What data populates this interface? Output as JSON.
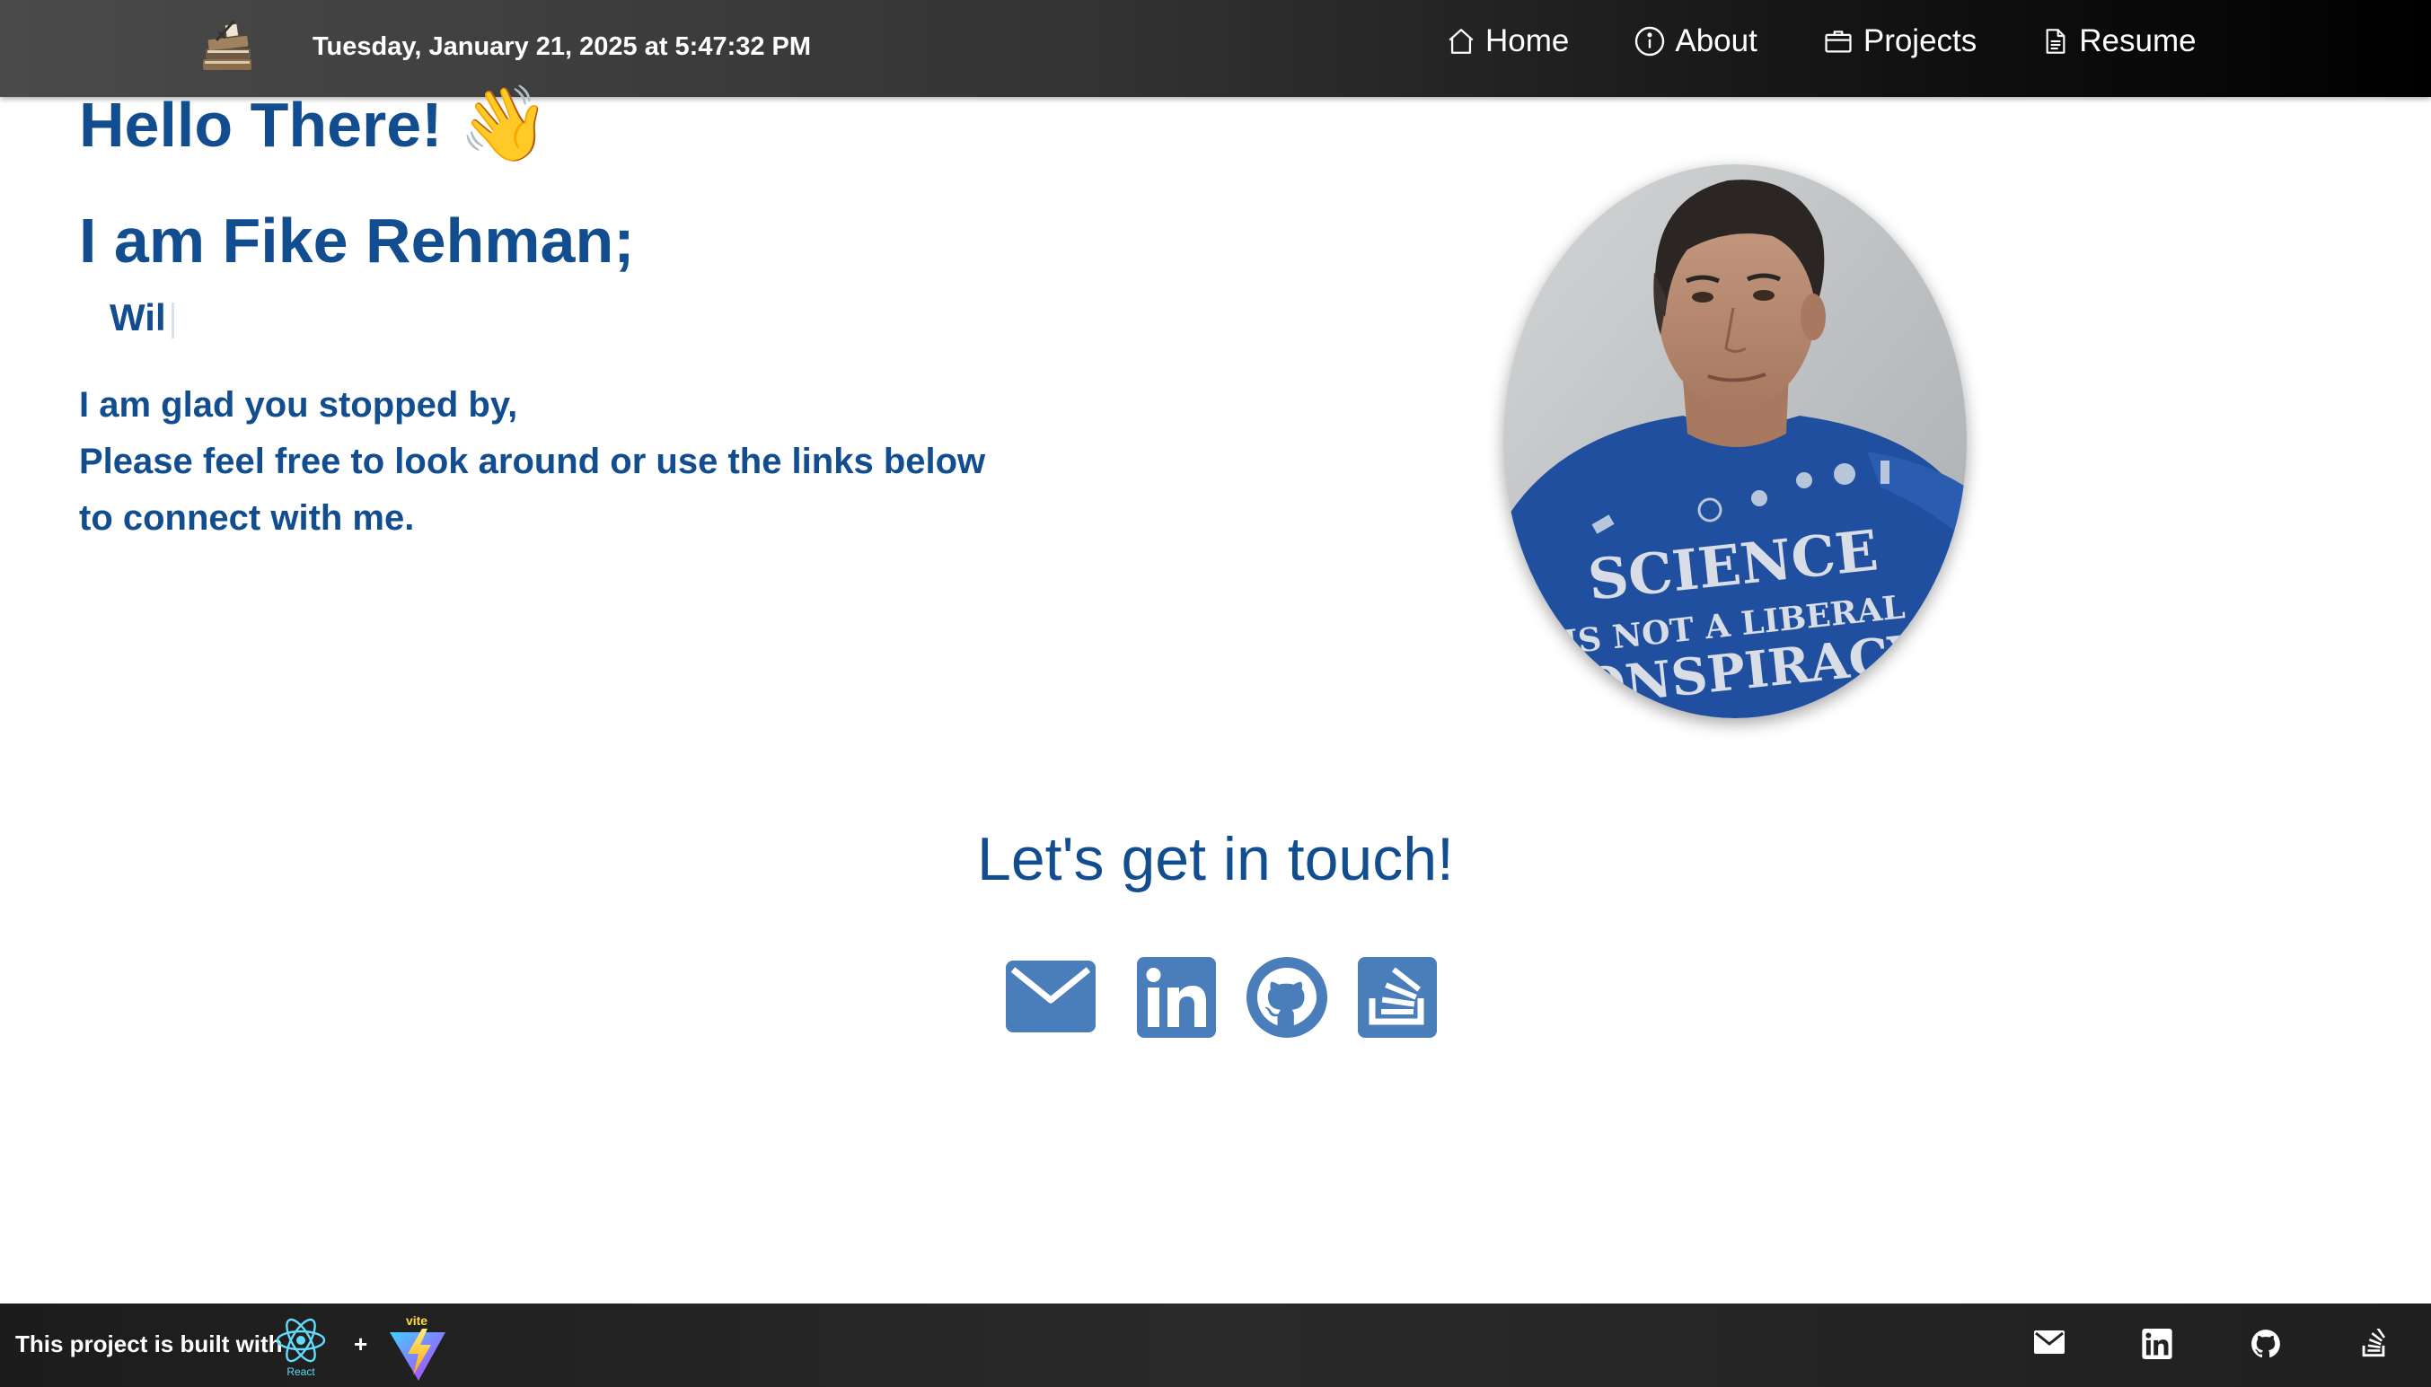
{
  "header": {
    "datetime": "Tuesday, January 21, 2025 at 5:47:32 PM",
    "nav": [
      {
        "label": "Home",
        "icon": "home-icon"
      },
      {
        "label": "About",
        "icon": "info-icon"
      },
      {
        "label": "Projects",
        "icon": "briefcase-icon"
      },
      {
        "label": "Resume",
        "icon": "document-icon"
      }
    ]
  },
  "hero": {
    "greeting_title": "Hello There!",
    "wave_emoji": "👋",
    "name_prefix": "I am ",
    "name": "Fike Rehman;",
    "typed_text": "Wil",
    "message_lines": [
      "I am glad you stopped by,",
      "Please feel free to look around or use the links below",
      "to connect with me."
    ],
    "portrait_shirt_lines": [
      "SCIENCE",
      "IS NOT A LIBERAL",
      "CONSPIRACY"
    ]
  },
  "contact": {
    "title": "Let's get in touch!",
    "icons": [
      "email-icon",
      "linkedin-icon",
      "github-icon",
      "stackoverflow-icon"
    ]
  },
  "footer": {
    "built_with": "This project is built with",
    "react_label": "React",
    "plus": "+",
    "vite_label": "vite",
    "icons": [
      "email-icon",
      "linkedin-icon",
      "github-icon",
      "stackoverflow-icon"
    ]
  },
  "colors": {
    "heading_blue": "#114d8f",
    "icon_blue": "#4a7ebb",
    "nav_bg": "#2a2a2a",
    "footer_bg": "#222222"
  }
}
